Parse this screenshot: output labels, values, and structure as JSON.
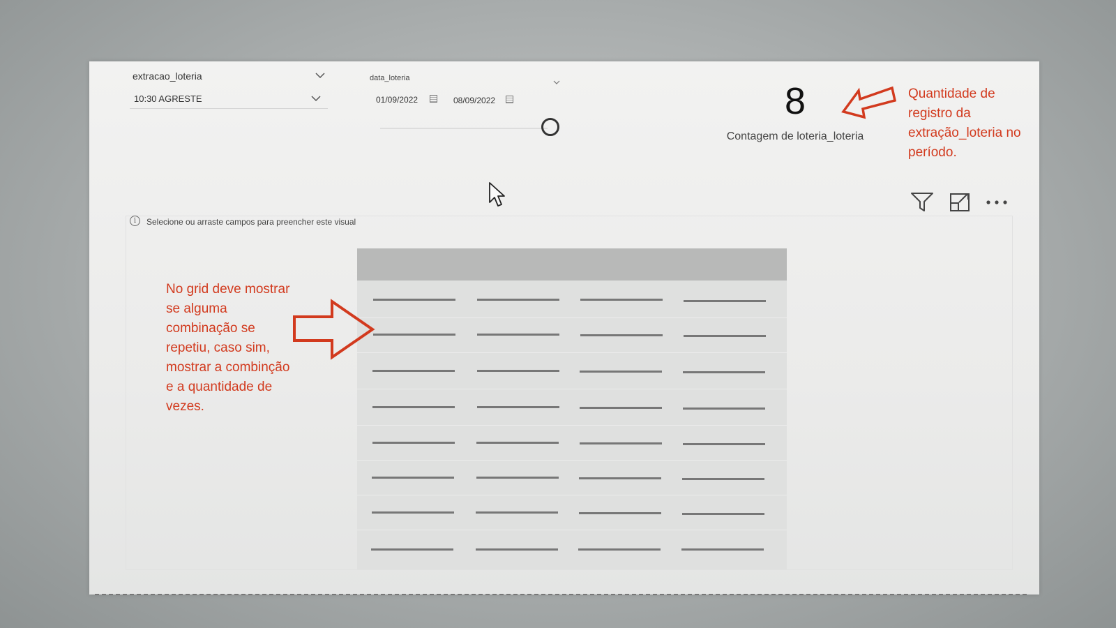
{
  "slicer_extracao": {
    "title": "extracao_loteria",
    "selected": "10:30 AGRESTE"
  },
  "slicer_data": {
    "title": "data_loteria",
    "start_date": "01/09/2022",
    "end_date": "08/09/2022"
  },
  "card": {
    "value": "8",
    "label": "Contagem de loteria_loteria"
  },
  "annotations": {
    "right_lines": [
      "Quantidade de",
      "registro da",
      "extração_loteria no",
      "período."
    ],
    "left_lines": [
      "No grid deve mostrar",
      "se alguma",
      "combinação se",
      "repetiu, caso sim,",
      "mostrar a combinção",
      "e a quantidade de",
      "vezes."
    ],
    "color": "#d23a1e"
  },
  "visual": {
    "placeholder": "Selecione ou arraste campos para preencher este visual",
    "header_icons": [
      "filter-icon",
      "focus-mode-icon",
      "more-options-icon"
    ]
  }
}
